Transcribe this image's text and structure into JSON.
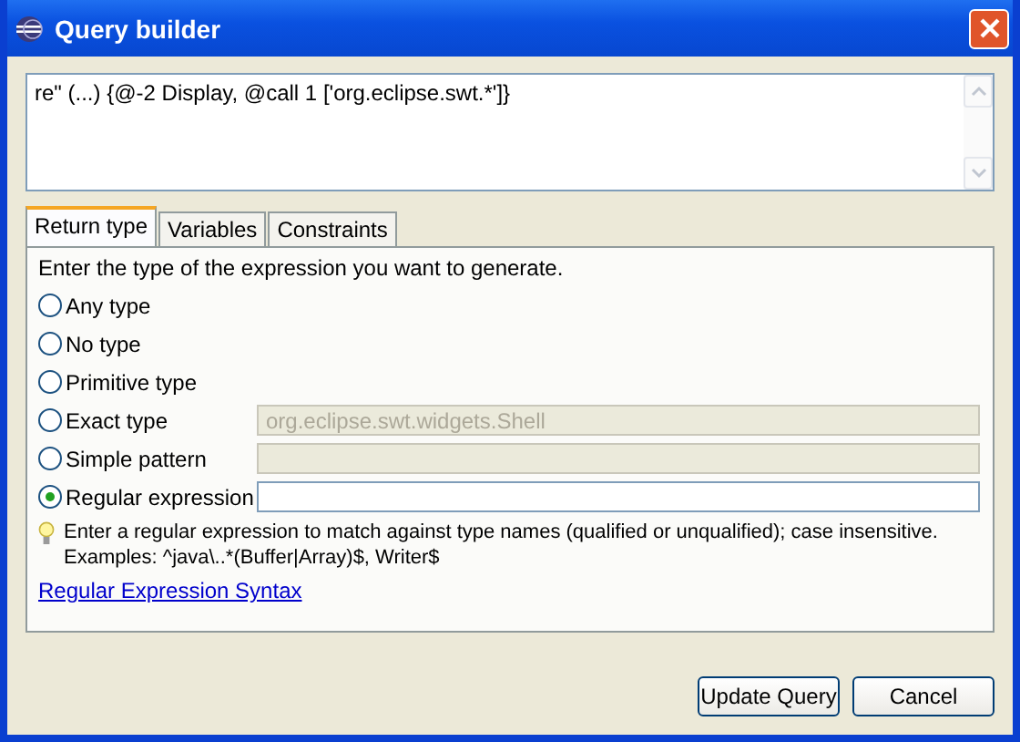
{
  "window": {
    "title": "Query builder"
  },
  "query_text": "re\" (...) {@-2 Display, @call 1 ['org.eclipse.swt.*']}",
  "tabs": [
    {
      "label": "Return type",
      "selected": true
    },
    {
      "label": "Variables",
      "selected": false
    },
    {
      "label": "Constraints",
      "selected": false
    }
  ],
  "instruction": "Enter the type of the expression you want to generate.",
  "options": [
    {
      "kind": "radio",
      "label": "Any type",
      "selected": false
    },
    {
      "kind": "radio",
      "label": "No type",
      "selected": false
    },
    {
      "kind": "radio",
      "label": "Primitive type",
      "selected": false
    },
    {
      "kind": "radio-field",
      "label": "Exact type",
      "selected": false,
      "field": {
        "disabled": true,
        "value": "org.eclipse.swt.widgets.Shell"
      }
    },
    {
      "kind": "radio-field",
      "label": "Simple pattern",
      "selected": false,
      "field": {
        "disabled": true
      }
    },
    {
      "kind": "radio-field",
      "label": "Regular expression",
      "selected": true,
      "field": {
        "disabled": false
      }
    }
  ],
  "hint_lines": [
    "Enter a regular expression to match against type names (qualified or unqualified); case insensitive.",
    "Examples: ^java\\..*(Buffer|Array)$, Writer$"
  ],
  "link": "Regular Expression Syntax",
  "buttons": [
    "Update Query",
    "Cancel"
  ]
}
